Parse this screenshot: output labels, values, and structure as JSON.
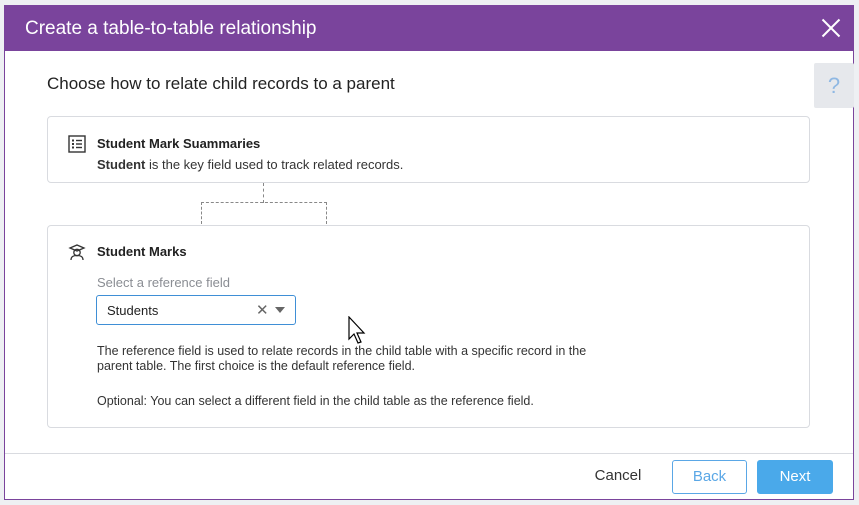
{
  "dialog": {
    "title": "Create a table-to-table relationship",
    "heading": "Choose how to relate child records to a parent",
    "help_label": "?",
    "colors": {
      "header": "#7a449c",
      "accent": "#4aa9ea"
    }
  },
  "parent_table": {
    "name": "Student Mark Suammaries",
    "key_field": "Student",
    "key_description": " is the key field used to track related records.",
    "icon": "list-icon"
  },
  "child_table": {
    "name": "Student Marks",
    "icon": "student-icon",
    "select_label": "Select a reference field",
    "selected_value": "Students",
    "description": "The reference field is used to relate records in the child table with a specific record in the parent table. The first choice is the default reference field.",
    "optional_note": "Optional: You can select a different field in the child table as the reference field."
  },
  "footer": {
    "cancel": "Cancel",
    "back": "Back",
    "next": "Next"
  }
}
